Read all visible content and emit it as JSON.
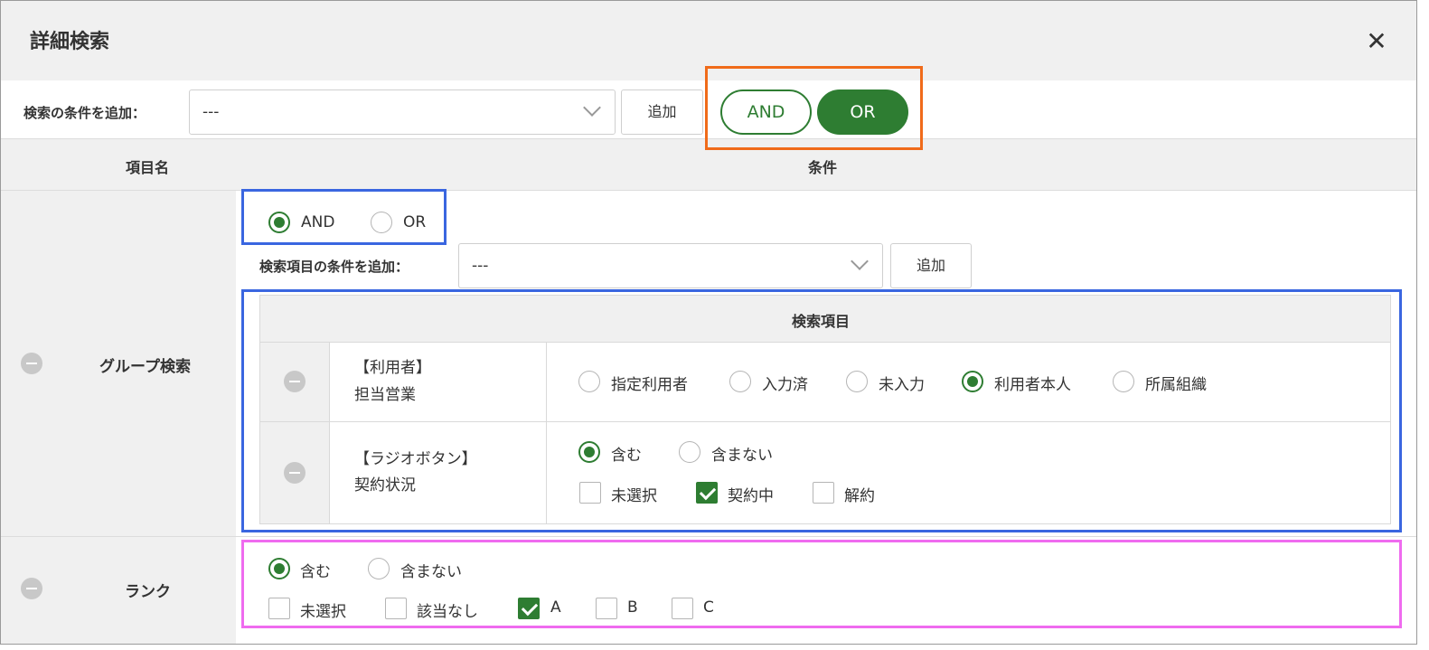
{
  "dialog": {
    "title": "詳細検索",
    "close_glyph": "✕"
  },
  "top_bar": {
    "add_label": "検索の条件を追加：",
    "select_value": "---",
    "add_button": "追加",
    "logic": {
      "and": "AND",
      "or": "OR",
      "selected": "OR"
    }
  },
  "table": {
    "col_item": "項目名",
    "col_condition": "条件"
  },
  "group_row": {
    "label": "グループ検索",
    "logic": {
      "and": "AND",
      "or": "OR",
      "selected": "AND"
    },
    "add_label": "検索項目の条件を追加：",
    "select_value": "---",
    "add_button": "追加",
    "inner_header": "検索項目",
    "items": [
      {
        "name_line1": "【利用者】",
        "name_line2": "担当営業",
        "options": [
          "指定利用者",
          "入力済",
          "未入力",
          "利用者本人",
          "所属組織"
        ],
        "selected": "利用者本人"
      },
      {
        "name_line1": "【ラジオボタン】",
        "name_line2": "契約状況",
        "match": [
          "含む",
          "含まない"
        ],
        "match_selected": "含む",
        "checks": [
          "未選択",
          "契約中",
          "解約"
        ],
        "checked": [
          "契約中"
        ]
      }
    ]
  },
  "rank_row": {
    "label": "ランク",
    "match": [
      "含む",
      "含まない"
    ],
    "match_selected": "含む",
    "checks": [
      "未選択",
      "該当なし",
      "A",
      "B",
      "C"
    ],
    "checked": [
      "A"
    ]
  },
  "colors": {
    "accent": "#2e7d32",
    "highlight_orange": "#f06b1a",
    "highlight_blue": "#3a66e0",
    "highlight_pink": "#ef6bef"
  }
}
